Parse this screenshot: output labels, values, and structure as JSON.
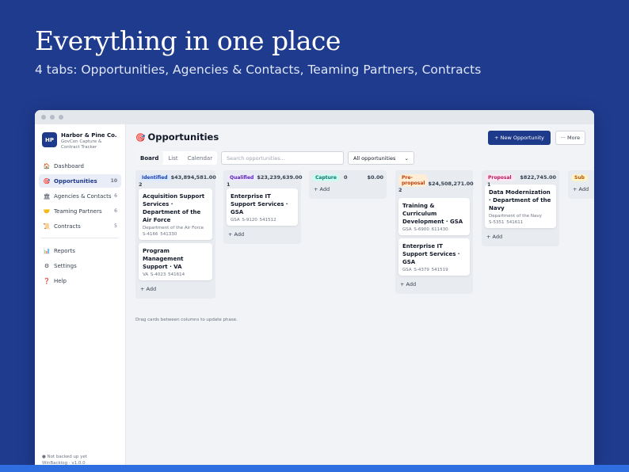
{
  "hero": {
    "title": "Everything in one place",
    "subtitle": "4 tabs: Opportunities, Agencies & Contacts, Teaming Partners, Contracts"
  },
  "colors": {
    "brand": "#1e3a8a",
    "background": "#1f3b8e",
    "accent_strip": "#2f6ee0"
  },
  "sidebar": {
    "logo": "HP",
    "app_name": "Harbor & Pine Co.",
    "tagline": "GovCon Capture & Contract Tracker",
    "items": [
      {
        "icon": "🏠",
        "icon_name": "home-icon",
        "label": "Dashboard",
        "count": ""
      },
      {
        "icon": "🎯",
        "icon_name": "target-icon",
        "label": "Opportunities",
        "count": "10"
      },
      {
        "icon": "🏛",
        "icon_name": "building-icon",
        "label": "Agencies & Contacts",
        "count": "6"
      },
      {
        "icon": "🤝",
        "icon_name": "handshake-icon",
        "label": "Teaming Partners",
        "count": "6"
      },
      {
        "icon": "📜",
        "icon_name": "scroll-icon",
        "label": "Contracts",
        "count": "5"
      }
    ],
    "secondary": [
      {
        "icon": "📊",
        "icon_name": "chart-icon",
        "label": "Reports"
      },
      {
        "icon": "⚙",
        "icon_name": "gear-icon",
        "label": "Settings"
      },
      {
        "icon": "❓",
        "icon_name": "help-icon",
        "label": "Help"
      }
    ],
    "footer_status": "● Not backed up yet",
    "footer_version": "WinBacklog · v1.0.0"
  },
  "main": {
    "title_icon": "🎯",
    "title": "Opportunities",
    "new_button": "+ New Opportunity",
    "more_button": "··· More",
    "tabs": [
      "Board",
      "List",
      "Calendar"
    ],
    "active_tab": "Board",
    "search_placeholder": "Search opportunities...",
    "filter_value": "All opportunities",
    "hint": "Drag cards between columns to update phase."
  },
  "board": {
    "add_label": "+ Add",
    "columns": [
      {
        "name": "Identified",
        "count": "2",
        "total": "$43,894,581.00",
        "badge_bg": "#dbeafe",
        "badge_fg": "#1e40af",
        "cards": [
          {
            "title": "Acquisition Support Services · Department of the Air Force",
            "agency": "Department of the Air Force",
            "meta": "S-4166   541330"
          },
          {
            "title": "Program Management Support · VA",
            "agency": "",
            "meta": "VA   S-4023   541614"
          }
        ]
      },
      {
        "name": "Qualified",
        "count": "1",
        "total": "$23,239,639.00",
        "badge_bg": "#ede9fe",
        "badge_fg": "#5b21b6",
        "cards": [
          {
            "title": "Enterprise IT Support Services · GSA",
            "agency": "",
            "meta": "GSA   S-9120   541512"
          }
        ]
      },
      {
        "name": "Capture",
        "count": "0",
        "total": "$0.00",
        "badge_bg": "#ccfbf1",
        "badge_fg": "#0f766e",
        "cards": []
      },
      {
        "name": "Pre-proposal",
        "count": "2",
        "total": "$24,508,271.00",
        "badge_bg": "#ffedd5",
        "badge_fg": "#c2410c",
        "cards": [
          {
            "title": "Training & Curriculum Development · GSA",
            "agency": "",
            "meta": "GSA   S-6900   611430"
          },
          {
            "title": "Enterprise IT Support Services · GSA",
            "agency": "",
            "meta": "GSA   S-4379   541519"
          }
        ]
      },
      {
        "name": "Proposal",
        "count": "1",
        "total": "$822,745.00",
        "badge_bg": "#fce7f3",
        "badge_fg": "#be185d",
        "cards": [
          {
            "title": "Data Modernization · Department of the Navy",
            "agency": "Department of the Navy",
            "meta": "S-5351   541611"
          }
        ]
      },
      {
        "name": "Sub",
        "count": "",
        "total": "",
        "badge_bg": "#fef3c7",
        "badge_fg": "#b45309",
        "cards": []
      }
    ]
  }
}
